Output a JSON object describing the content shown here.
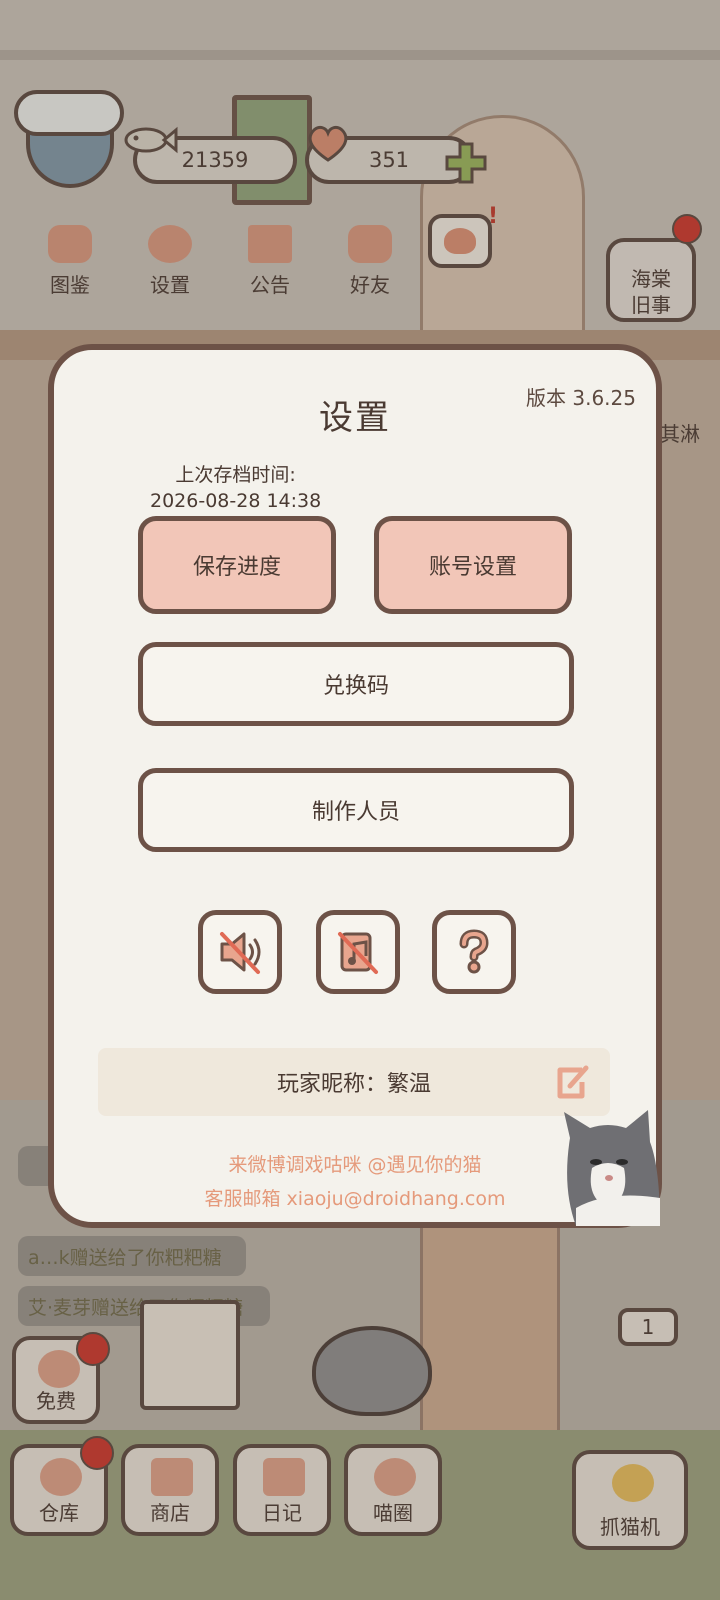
{
  "currency": {
    "coins": "21359",
    "hearts": "351"
  },
  "top_menu": [
    {
      "label": "图鉴"
    },
    {
      "label": "设置"
    },
    {
      "label": "公告"
    },
    {
      "label": "好友"
    }
  ],
  "event_button": {
    "label_line1": "海棠",
    "label_line2": "旧事"
  },
  "side_tag": "其淋",
  "dialog": {
    "title": "设置",
    "version": "版本 3.6.25",
    "save_time_label": "上次存档时间:",
    "save_time_value": "2026-08-28 14:38",
    "save_button": "保存进度",
    "account_button": "账号设置",
    "redeem_button": "兑换码",
    "credits_button": "制作人员",
    "nickname_text": "玩家昵称：繁温",
    "weibo_line": "来微博调戏咕咪 @遇见你的猫",
    "email_line": "客服邮箱 xiaoju@droidhang.com"
  },
  "chat": [
    {
      "text": ""
    },
    {
      "text": "a…k赠送给了你粑粑糖"
    },
    {
      "text": "艾·麦芽赠送给了你粑粑糖"
    }
  ],
  "bottom_bar": {
    "free": "免费",
    "store": "仓库",
    "shop": "商店",
    "diary": "日记",
    "circle": "喵圈",
    "claw": "抓猫机",
    "counter": "1"
  },
  "colors": {
    "accent": "#f2c6b8",
    "border": "#6d5247",
    "dialog_bg": "#f4f2ec",
    "link": "#e59a7b",
    "badge": "#c9372c"
  }
}
